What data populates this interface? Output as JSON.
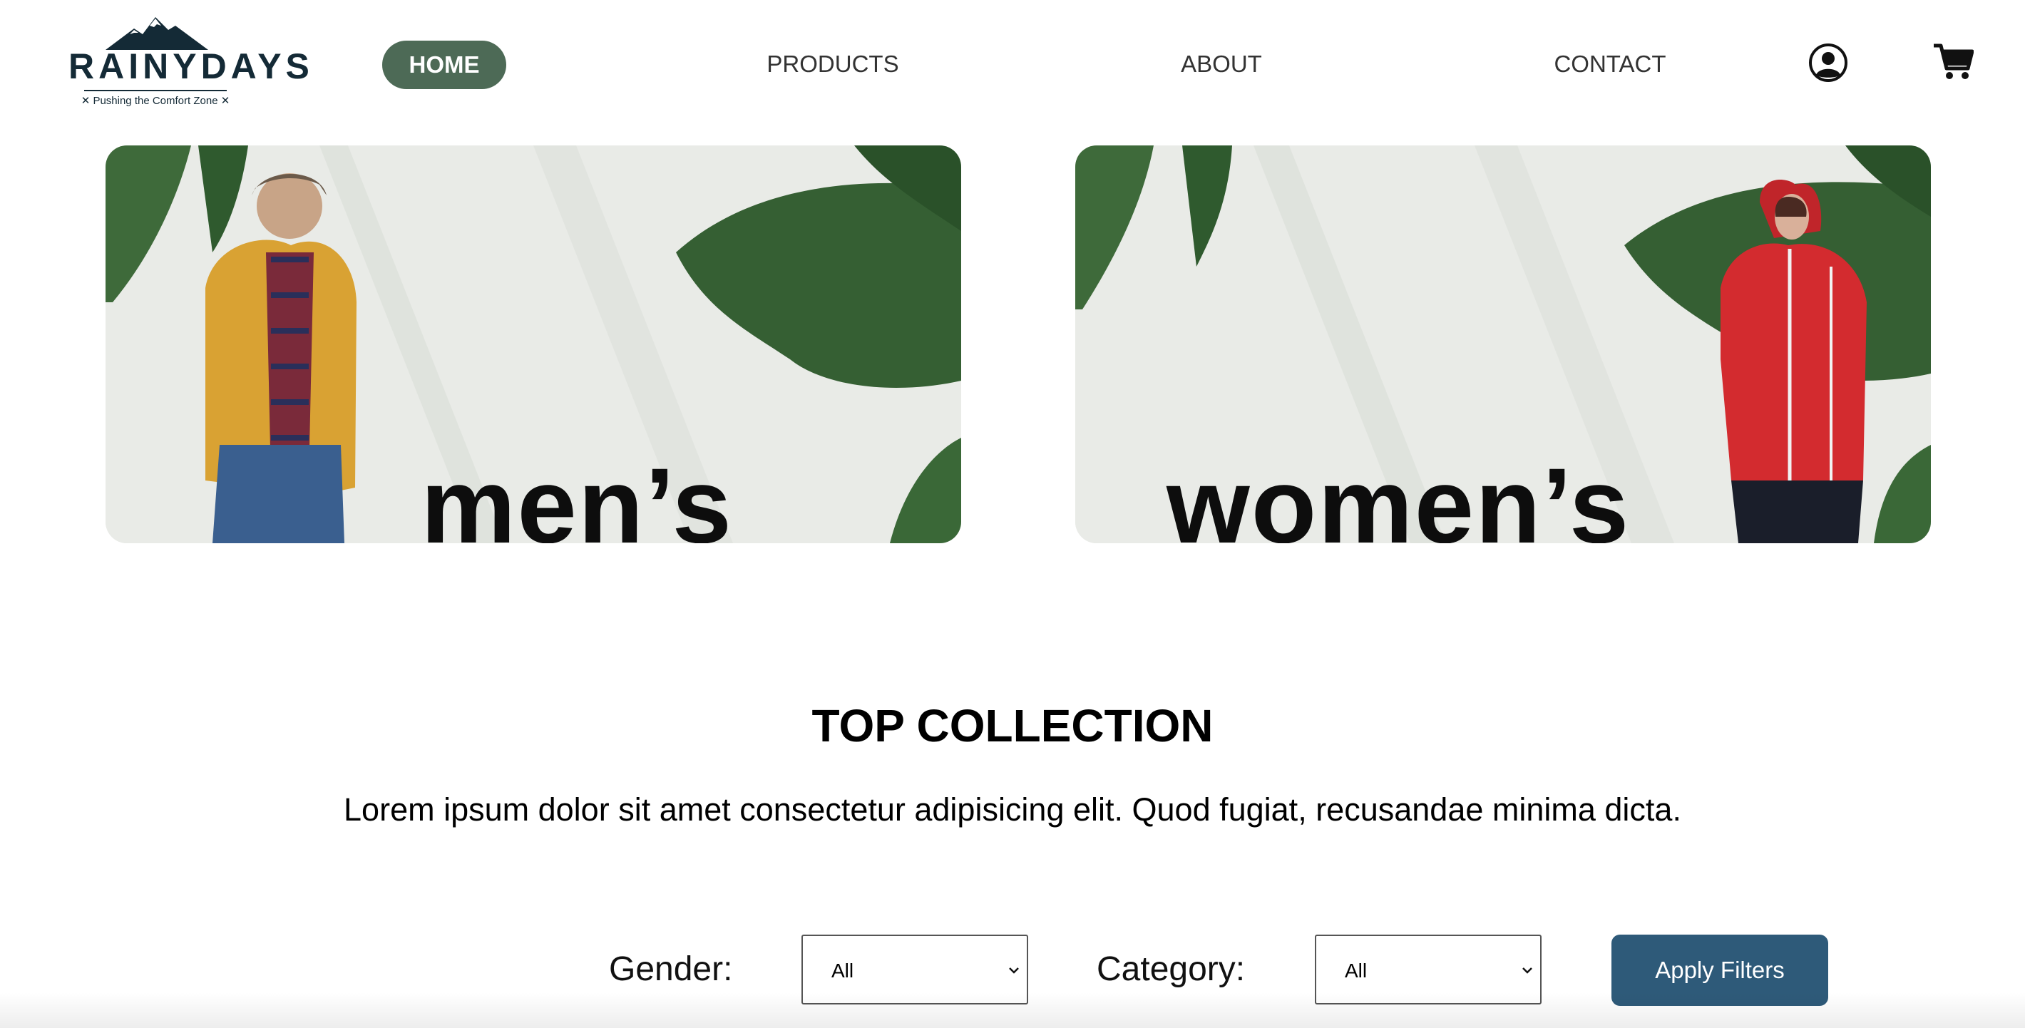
{
  "brand": {
    "name": "RAINYDAYS",
    "tagline": "✕ Pushing the Comfort Zone ✕",
    "color": "#142a36"
  },
  "nav": {
    "items": [
      {
        "label": "HOME",
        "active": true
      },
      {
        "label": "PRODUCTS",
        "active": false
      },
      {
        "label": "ABOUT",
        "active": false
      },
      {
        "label": "CONTACT",
        "active": false
      }
    ],
    "active_color": "#4d6a56",
    "account_icon": "user-circle-icon",
    "cart_icon": "shopping-cart-icon"
  },
  "hero": {
    "men_label": "men’s",
    "women_label": "women’s"
  },
  "collection": {
    "title": "TOP COLLECTION",
    "description": "Lorem ipsum dolor sit amet consectetur adipisicing elit. Quod fugiat, recusandae minima dicta."
  },
  "filters": {
    "gender_label": "Gender:",
    "gender_value": "All",
    "category_label": "Category:",
    "category_value": "All",
    "apply_label": "Apply Filters",
    "apply_color": "#2e5a79"
  }
}
